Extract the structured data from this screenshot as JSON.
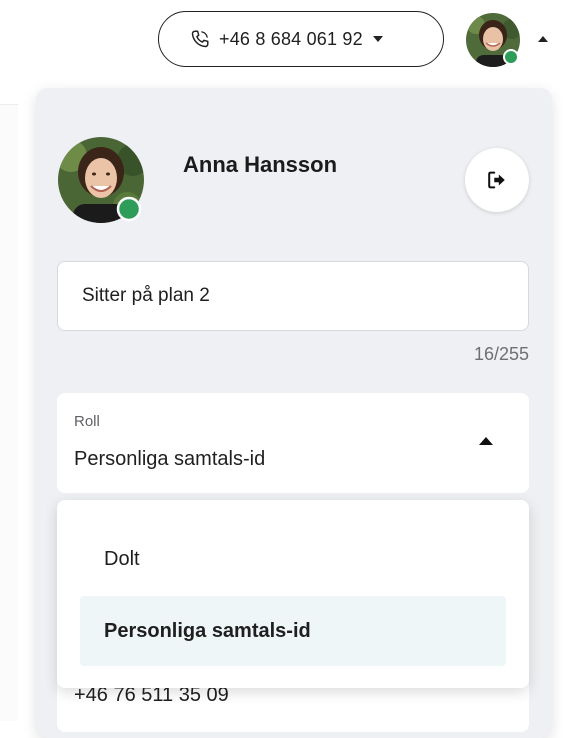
{
  "header": {
    "phone_number": "+46 8 684 061 92",
    "phone_icon": "phone-icon",
    "account_caret_icon": "chevron-up-icon"
  },
  "profile": {
    "name": "Anna Hansson",
    "presence_status": "online",
    "logout_icon": "logout-icon"
  },
  "status_message": {
    "value": "Sitter på plan 2",
    "counter": "16/255"
  },
  "role": {
    "label": "Roll",
    "selected": "Personliga samtals-id",
    "options": [
      "Dolt",
      "Personliga samtals-id"
    ],
    "highlighted_index": 1
  },
  "phone_field": {
    "value": "+46 76 511 35 09"
  },
  "colors": {
    "online": "#2e9d5a",
    "panel_bg": "#eef0f3",
    "option_highlight": "#eef6f8"
  }
}
